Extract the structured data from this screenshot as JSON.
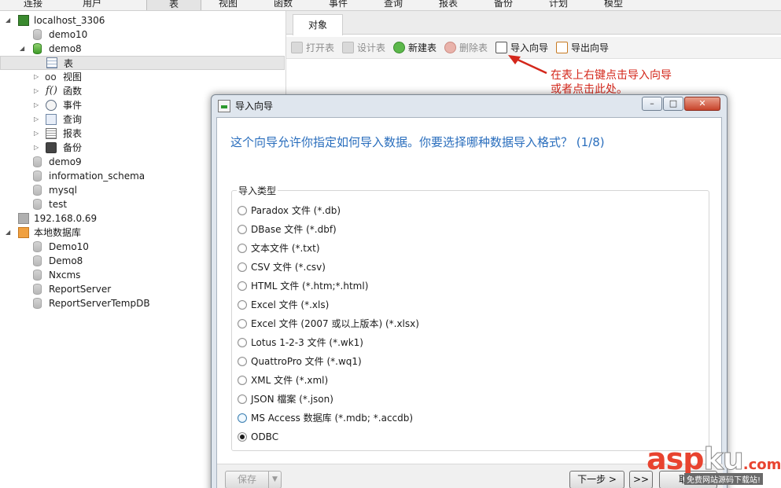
{
  "toolbar": {
    "items": [
      "连接",
      "用户",
      "表",
      "视图",
      "函数",
      "事件",
      "查询",
      "报表",
      "备份",
      "计划",
      "模型"
    ],
    "active": "表"
  },
  "tree": {
    "conn1": "localhost_3306",
    "db_demo10": "demo10",
    "db_demo8": "demo8",
    "tables": "表",
    "views": "视图",
    "functions": "函数",
    "events": "事件",
    "queries": "查询",
    "reports": "报表",
    "backups": "备份",
    "db_demo9": "demo9",
    "db_info": "information_schema",
    "db_mysql": "mysql",
    "db_test": "test",
    "conn2": "192.168.0.69",
    "conn3": "本地数据库",
    "db_Demo10": "Demo10",
    "db_Demo8": "Demo8",
    "db_Nxcms": "Nxcms",
    "db_rs": "ReportServer",
    "db_rstemp": "ReportServerTempDB"
  },
  "objects": {
    "tab": "对象",
    "open": "打开表",
    "design": "设计表",
    "new": "新建表",
    "delete": "删除表",
    "import": "导入向导",
    "export": "导出向导"
  },
  "annotation": {
    "line1": "在表上右键点击导入向导",
    "line2": "或者点击此处。"
  },
  "dialog": {
    "title": "导入向导",
    "heading": "这个向导允许你指定如何导入数据。你要选择哪种数据导入格式？ (1/8)",
    "group_label": "导入类型",
    "options": [
      "Paradox 文件 (*.db)",
      "DBase 文件 (*.dbf)",
      "文本文件 (*.txt)",
      "CSV 文件 (*.csv)",
      "HTML 文件 (*.htm;*.html)",
      "Excel 文件 (*.xls)",
      "Excel 文件 (2007 或以上版本) (*.xlsx)",
      "Lotus 1-2-3 文件 (*.wk1)",
      "QuattroPro 文件 (*.wq1)",
      "XML 文件 (*.xml)",
      "JSON 檔案 (*.json)",
      "MS Access 数据库 (*.mdb; *.accdb)",
      "ODBC"
    ],
    "selected": "ODBC",
    "save": "保存",
    "next": "下一步 >",
    "last": ">>",
    "cancel": "取消"
  },
  "watermark": {
    "logo_asp": "asp",
    "logo_ku": "ku",
    "logo_com": ".com",
    "sub": "免费网站源码下载站!"
  }
}
